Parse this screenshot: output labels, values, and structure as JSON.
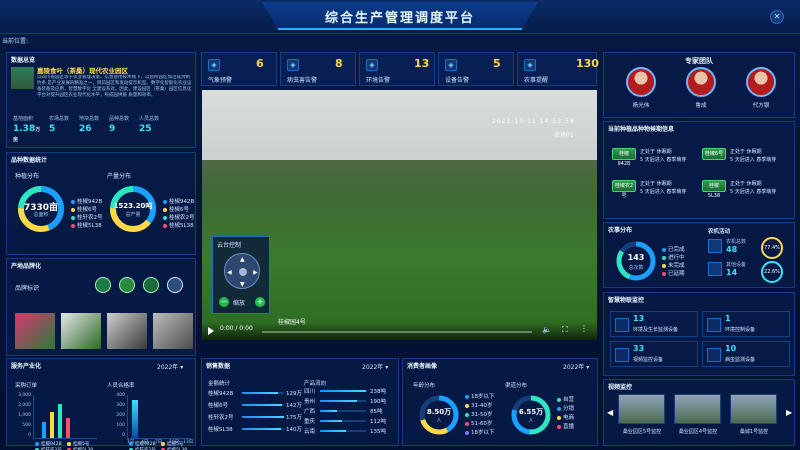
{
  "header": {
    "title": "综合生产管理调度平台",
    "close_icon": "close-icon",
    "location_label": "当前位置:"
  },
  "colors": {
    "accent": "#37e3ff",
    "highlight": "#ffd84a",
    "panel_bg": "#061c48",
    "border": "#0f3d86"
  },
  "left": {
    "overview": {
      "title": "数据总览",
      "heading": "嘉陵食叶（茶桑）现代农业园区",
      "desc": "以四川省园区等于农业管理决策，信息使用技术线下，以您所园区加活成为制约条 是产业发展的精准之一，目前园区和发动提示机型。数字化智能化农业设备装备及应用，智慧数字化 全建设系对。因此，建设园区（茶桑）园区信息化平台对提升园区农业现代化水平，构成园供质 质量和效率。",
      "stats": [
        {
          "label": "基地面积",
          "value": "1.38",
          "unit": "万亩"
        },
        {
          "label": "农场总数",
          "value": "5",
          "unit": ""
        },
        {
          "label": "地块总数",
          "value": "26",
          "unit": ""
        },
        {
          "label": "品种总数",
          "value": "9",
          "unit": ""
        },
        {
          "label": "人员总数",
          "value": "25",
          "unit": ""
        }
      ]
    },
    "variety": {
      "title": "品种数据统计",
      "plant_title": "种植分布",
      "plant_value": "7330亩",
      "plant_sub": "总面积",
      "plant_legend": [
        "桂椒942B",
        "桂椒6号",
        "桂轩农2号",
        "桂椒5L38"
      ],
      "yield_title": "产量分布",
      "yield_value": "1523.20吨",
      "yield_sub": "总产量",
      "yield_legend": [
        "桂椒942B",
        "桂椒6号",
        "桂椒农2号",
        "桂椒5L38"
      ]
    },
    "brand": {
      "title": "产地品牌化",
      "brand_label": "品牌标识",
      "logo_icons": [
        "badge-icon-1",
        "badge-icon-2",
        "badge-icon-3",
        "badge-icon-4"
      ]
    },
    "service": {
      "title": "服务产业化",
      "year": "2022年",
      "sales_title": "采购订单",
      "sales_y": [
        "3,000",
        "2,000",
        "1,000",
        "500",
        "0"
      ],
      "sales_legend": [
        "桂椒942B",
        "桂椒5号",
        "桂轩农2号",
        "桂椒5L38"
      ],
      "invest_title": "人员合格率",
      "invest_y": [
        "400",
        "300",
        "200",
        "100",
        "0"
      ],
      "invest_x": [
        "1日",
        "4日",
        "7日",
        "10日",
        "13日"
      ],
      "invest_legend": [
        "桂椒942B",
        "桂椒5号",
        "桂轩农2号",
        "桂椒5L38"
      ]
    }
  },
  "kpi": [
    {
      "label": "气象预警",
      "value": "6",
      "icon": "weather-icon"
    },
    {
      "label": "病虫害告警",
      "value": "8",
      "icon": "bug-icon"
    },
    {
      "label": "环境告警",
      "value": "13",
      "icon": "environment-icon"
    },
    {
      "label": "设备告警",
      "value": "5",
      "icon": "device-icon"
    },
    {
      "label": "农事提醒",
      "value": "130",
      "icon": "calendar-icon"
    }
  ],
  "video": {
    "osd_time": "2023-10-11 14:53:58",
    "osd_channel": "农场01",
    "watermark": "桂椒园4号",
    "ptz_title": "云台控制",
    "ptz_zoom": "缩放",
    "time": "0:00 / 0:00"
  },
  "sales": {
    "title": "销售数据",
    "year": "2022年",
    "total_title": "金额统计",
    "total_rows": [
      {
        "name": "桂椒942B",
        "value": "129万",
        "pct": 0.86
      },
      {
        "name": "桂椒6号",
        "value": "142万",
        "pct": 0.95
      },
      {
        "name": "桂轩农2号",
        "value": "175万",
        "pct": 1.0
      },
      {
        "name": "桂椒5L38",
        "value": "140万",
        "pct": 0.92
      }
    ],
    "flow_title": "产品流向",
    "flow_rows": [
      {
        "name": "四川",
        "value": "238吨",
        "pct": 1.0
      },
      {
        "name": "贵州",
        "value": "190吨",
        "pct": 0.8
      },
      {
        "name": "广西",
        "value": "85吨",
        "pct": 0.36
      },
      {
        "name": "重庆",
        "value": "112吨",
        "pct": 0.47
      },
      {
        "name": "云南",
        "value": "135吨",
        "pct": 0.57
      }
    ]
  },
  "consumer": {
    "title": "消费者画像",
    "year": "2022年",
    "age_title": "年龄分布",
    "age_value": "8.50万",
    "age_sub": "人",
    "age_legend": [
      "18岁以下",
      "31-40岁",
      "31-50岁",
      "51-60岁",
      "18岁以下"
    ],
    "region_title": "渠道分布",
    "region_value": "6.55万",
    "region_sub": "人",
    "region_legend": [
      "自营",
      "分销",
      "电商",
      "直播"
    ]
  },
  "right": {
    "experts": {
      "title": "专家团队",
      "people": [
        {
          "name": "杨光伟"
        },
        {
          "name": "鲁成"
        },
        {
          "name": "代方银"
        }
      ]
    },
    "growth": {
      "title": "当前种植品种物候期信息",
      "items": [
        {
          "chip": "桂椒942B",
          "line1": "正处于 休眠期",
          "line2": "5 天后进入 春季萌芽"
        },
        {
          "chip": "桂椒6号",
          "line1": "正处于 休眠期",
          "line2": "5 天后进入 春季萌芽"
        },
        {
          "chip": "桂椒农2号",
          "line1": "正处于 休眠期",
          "line2": "5 天后进入 春季萌芽"
        },
        {
          "chip": "桂椒5L38",
          "line1": "正处于 休眠期",
          "line2": "5 天后进入 春季萌芽"
        }
      ]
    },
    "farmer": {
      "title": "农事分布",
      "value": "143",
      "sub": "总次数",
      "legend": [
        "已完成",
        "进行中",
        "未完成",
        "已延期"
      ],
      "stat_title": "农机活动",
      "stat1": {
        "label": "农机总数",
        "value": "48"
      },
      "stat2": {
        "label": "其他设备",
        "value": "14"
      },
      "pct1": "77.4%",
      "pct2": "22.6%"
    },
    "iot": {
      "title": "智慧物联监控",
      "items": [
        {
          "value": "13",
          "label": "环境及生长监测设备"
        },
        {
          "value": "1",
          "label": "环境控制设备"
        },
        {
          "value": "33",
          "label": "视频监控设备"
        },
        {
          "value": "10",
          "label": "病虫监测设备"
        }
      ]
    },
    "cams": {
      "title": "视频监控",
      "items": [
        {
          "label": "桑业园区5号监控"
        },
        {
          "label": "桑业园区4号监控"
        },
        {
          "label": "桑城1号监控"
        }
      ]
    }
  }
}
